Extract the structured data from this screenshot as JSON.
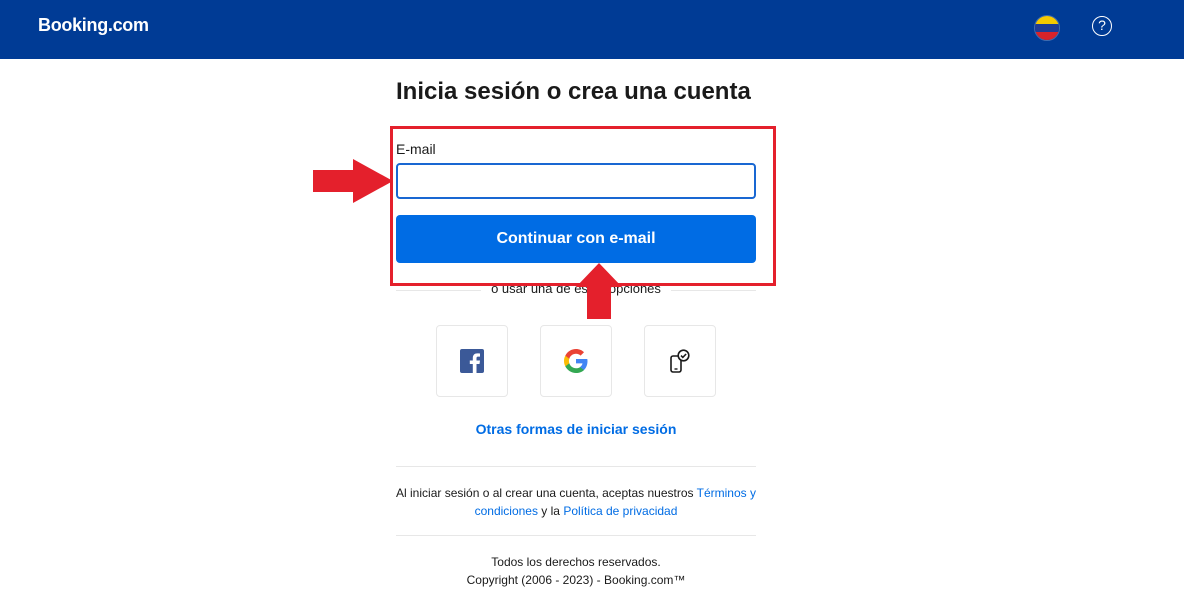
{
  "header": {
    "logo": "Booking.com",
    "help_symbol": "?",
    "flag_colors": [
      "#f7c900",
      "#1f3b95",
      "#d8232a"
    ]
  },
  "main": {
    "title": "Inicia sesión o crea una cuenta",
    "email_label": "E-mail",
    "email_value": "",
    "continue_label": "Continuar con e-mail",
    "divider_text": "o usar una de estas opciones",
    "social": {
      "facebook_icon": "facebook-icon",
      "google_icon": "google-icon",
      "passkey_icon": "device-check-icon"
    },
    "other_link": "Otras formas de iniciar sesión"
  },
  "legal": {
    "prefix": "Al iniciar sesión o al crear una cuenta, aceptas nuestros ",
    "terms_link": "Términos y condiciones",
    "and": " y la ",
    "privacy_link": "Política de privacidad"
  },
  "footer": {
    "line1": "Todos los derechos reservados.",
    "line2": "Copyright (2006 - 2023) - Booking.com™"
  },
  "colors": {
    "header_bg": "#003b95",
    "primary": "#006ce4",
    "annotation": "#e4202c"
  }
}
